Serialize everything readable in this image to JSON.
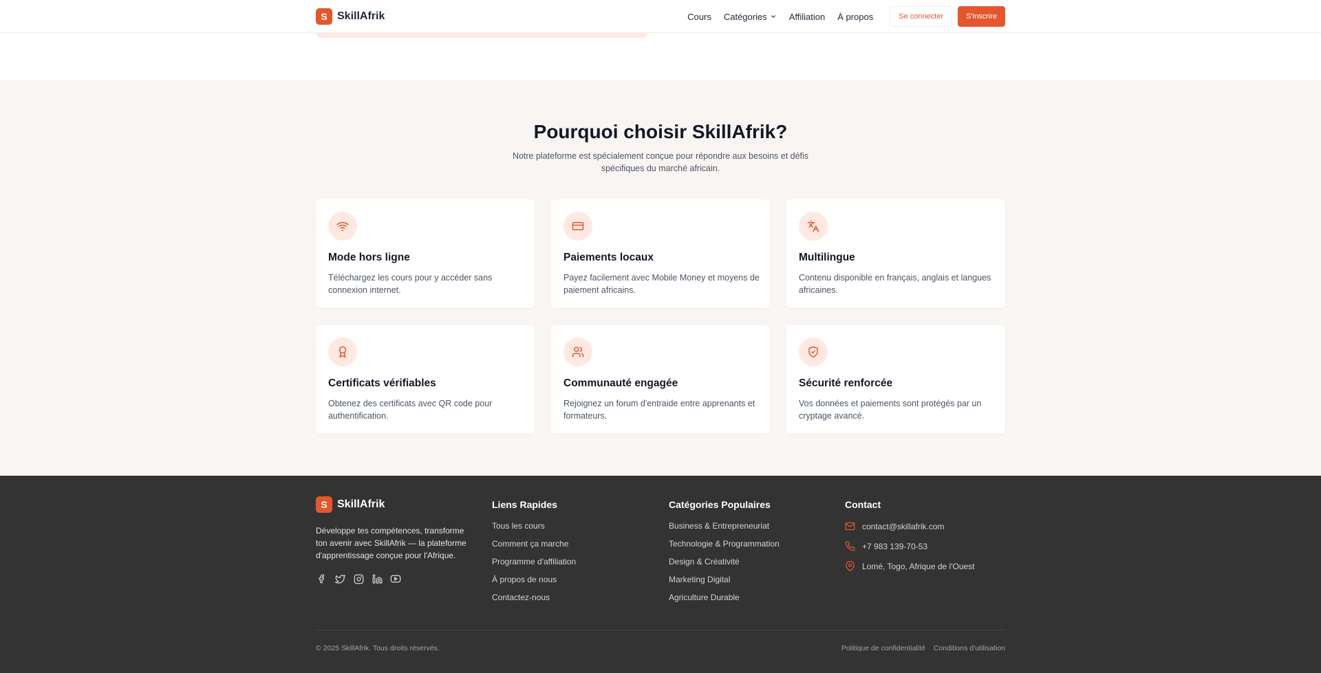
{
  "brand": {
    "logo_letter": "S",
    "name": "SkillAfrik",
    "accent": "#e4572e"
  },
  "nav": {
    "links": [
      "Cours",
      "Catégories",
      "Affiliation",
      "À propos"
    ],
    "login": "Se connecter",
    "signup": "S'inscrire"
  },
  "why": {
    "title": "Pourquoi choisir SkillAfrik?",
    "subtitle": "Notre plateforme est spécialement conçue pour répondre aux besoins et défis spécifiques du marché africain.",
    "features": [
      {
        "icon": "wifi-icon",
        "title": "Mode hors ligne",
        "desc": "Téléchargez les cours pour y accéder sans connexion internet."
      },
      {
        "icon": "credit-card-icon",
        "title": "Paiements locaux",
        "desc": "Payez facilement avec Mobile Money et moyens de paiement africains."
      },
      {
        "icon": "languages-icon",
        "title": "Multilingue",
        "desc": "Contenu disponible en français, anglais et langues africaines."
      },
      {
        "icon": "award-icon",
        "title": "Certificats vérifiables",
        "desc": "Obtenez des certificats avec QR code pour authentification."
      },
      {
        "icon": "users-icon",
        "title": "Communauté engagée",
        "desc": "Rejoignez un forum d'entraide entre apprenants et formateurs."
      },
      {
        "icon": "shield-check-icon",
        "title": "Sécurité renforcée",
        "desc": "Vos données et paiements sont protégés par un cryptage avancé."
      }
    ]
  },
  "footer": {
    "description": "Développe tes compétences, transforme ton avenir avec SkillAfrik — la plateforme d'apprentissage conçue pour l'Afrique.",
    "socials": [
      "facebook-icon",
      "twitter-icon",
      "instagram-icon",
      "linkedin-icon",
      "youtube-icon"
    ],
    "quick_links": {
      "title": "Liens Rapides",
      "items": [
        "Tous les cours",
        "Comment ça marche",
        "Programme d'affiliation",
        "À propos de nous",
        "Contactez-nous"
      ]
    },
    "categories": {
      "title": "Catégories Populaires",
      "items": [
        "Business & Entrepreneuriat",
        "Technologie & Programmation",
        "Design & Créativité",
        "Marketing Digital",
        "Agriculture Durable"
      ]
    },
    "contact": {
      "title": "Contact",
      "email": "contact@skillafrik.com",
      "phone": "+7 983 139-70-53",
      "address": "Lomé, Togo, Afrique de l'Ouest"
    },
    "copyright": "© 2025 SkillAfrik. Tous droits réservés.",
    "privacy": "Politique de confidentialité",
    "terms": "Conditions d'utilisation"
  }
}
